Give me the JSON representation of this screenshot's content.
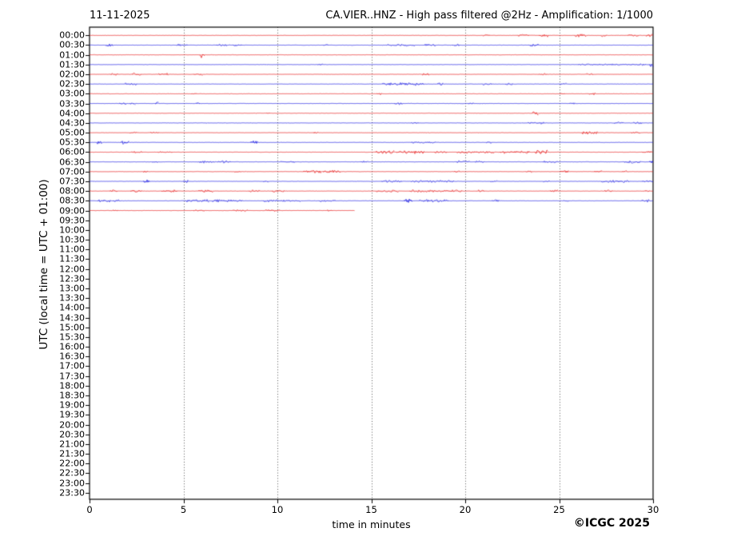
{
  "header": {
    "date": "11-11-2025",
    "title": "CA.VIER..HNZ - High pass filtered @2Hz - Amplification: 1/1000"
  },
  "footer": {
    "xlabel": "time in minutes",
    "copyright": "©ICGC 2025"
  },
  "chart_data": {
    "type": "line",
    "subtype": "helicorder-seismogram",
    "title": "CA.VIER..HNZ - High pass filtered @2Hz - Amplification: 1/1000",
    "date": "11-11-2025",
    "xlabel": "time in minutes",
    "ylabel": "UTC (local time = UTC + 01:00)",
    "xlim": [
      0,
      30
    ],
    "xticks": [
      "0",
      "5",
      "10",
      "15",
      "20",
      "25",
      "30"
    ],
    "grid_ticks_minutes": [
      5,
      10,
      15,
      20,
      25
    ],
    "grid": "vertical-dotted",
    "minutes_per_line": 30,
    "row_labels": [
      "00:00",
      "00:30",
      "01:00",
      "01:30",
      "02:00",
      "02:30",
      "03:00",
      "03:30",
      "04:00",
      "04:30",
      "05:00",
      "05:30",
      "06:00",
      "06:30",
      "07:00",
      "07:30",
      "08:00",
      "08:30",
      "09:00",
      "09:30",
      "10:00",
      "10:30",
      "11:00",
      "11:30",
      "12:00",
      "12:30",
      "13:00",
      "13:30",
      "14:00",
      "14:30",
      "15:00",
      "15:30",
      "16:00",
      "16:30",
      "17:00",
      "17:30",
      "18:00",
      "18:30",
      "19:00",
      "19:30",
      "20:00",
      "20:30",
      "21:00",
      "21:30",
      "22:00",
      "22:30",
      "23:00",
      "23:30"
    ],
    "colors": {
      "red": "#e51414",
      "blue": "#1919e0",
      "grid": "#555555",
      "frame": "#000000"
    },
    "last_data_row": "09:00",
    "traces": [
      {
        "label": "00:00",
        "color": "red",
        "start_min": 0,
        "end_min": 30,
        "bursts": [
          [
            20.9,
            21.3,
            1.4
          ],
          [
            22.8,
            23.4,
            1.6
          ],
          [
            23.9,
            24.4,
            1.8
          ],
          [
            25.8,
            26.4,
            1.9
          ],
          [
            27.2,
            27.5,
            1.7
          ],
          [
            28.6,
            29.2,
            1.6
          ],
          [
            29.6,
            30,
            1.8
          ]
        ]
      },
      {
        "label": "00:30",
        "color": "blue",
        "start_min": 0,
        "end_min": 30,
        "bursts": [
          [
            0.85,
            1.2,
            1.9
          ],
          [
            4.6,
            5.2,
            1.4
          ],
          [
            6.7,
            7.3,
            1.4
          ],
          [
            7.6,
            8.1,
            1.4
          ],
          [
            12.4,
            12.7,
            1.3
          ],
          [
            15.8,
            17.3,
            1.3
          ],
          [
            17.8,
            18.4,
            1.5
          ],
          [
            19.3,
            19.7,
            1.4
          ],
          [
            23.4,
            23.9,
            1.8
          ]
        ]
      },
      {
        "label": "01:00",
        "color": "red",
        "start_min": 0,
        "end_min": 30,
        "bursts": [
          [
            5.85,
            6.1,
            3.6
          ]
        ]
      },
      {
        "label": "01:30",
        "color": "blue",
        "start_min": 0,
        "end_min": 30,
        "bursts": [
          [
            12.1,
            12.4,
            1.2
          ],
          [
            26,
            29.6,
            1.25
          ],
          [
            29.75,
            30,
            2.6
          ]
        ]
      },
      {
        "label": "02:00",
        "color": "red",
        "start_min": 0,
        "end_min": 30,
        "bursts": [
          [
            1.1,
            1.5,
            1.3
          ],
          [
            2.25,
            2.75,
            1.6
          ],
          [
            3.65,
            4.15,
            1.5
          ],
          [
            5.5,
            6,
            1.3
          ],
          [
            17.7,
            18.05,
            1.7
          ],
          [
            23.9,
            24.3,
            1.3
          ],
          [
            26.4,
            26.8,
            1.3
          ]
        ]
      },
      {
        "label": "02:30",
        "color": "blue",
        "start_min": 0,
        "end_min": 30,
        "bursts": [
          [
            1.85,
            2.5,
            1.7
          ],
          [
            15.55,
            16.6,
            1.8
          ],
          [
            16.6,
            17.75,
            1.9
          ],
          [
            18.5,
            18.8,
            1.9
          ],
          [
            20.9,
            21.4,
            1.5
          ],
          [
            22.1,
            22.5,
            1.5
          ],
          [
            25,
            25.4,
            1.3
          ]
        ]
      },
      {
        "label": "03:00",
        "color": "red",
        "start_min": 0,
        "end_min": 30,
        "bursts": [
          [
            5.4,
            5.7,
            1.2
          ],
          [
            15.25,
            15.5,
            1.4
          ],
          [
            25,
            25.3,
            1.4
          ],
          [
            26.55,
            26.9,
            1.4
          ]
        ]
      },
      {
        "label": "03:30",
        "color": "blue",
        "start_min": 0,
        "end_min": 30,
        "bursts": [
          [
            1.55,
            1.95,
            1.6
          ],
          [
            2.1,
            2.4,
            1.6
          ],
          [
            3.45,
            3.65,
            2
          ],
          [
            5.65,
            5.85,
            1.9
          ],
          [
            16.2,
            16.6,
            1.6
          ],
          [
            20.1,
            20.4,
            1.3
          ],
          [
            25.5,
            25.8,
            1.3
          ]
        ]
      },
      {
        "label": "04:00",
        "color": "red",
        "start_min": 0,
        "end_min": 30,
        "bursts": [
          [
            9.4,
            9.6,
            1.2
          ],
          [
            23.55,
            23.85,
            2.2
          ]
        ]
      },
      {
        "label": "04:30",
        "color": "blue",
        "start_min": 0,
        "end_min": 30,
        "bursts": [
          [
            17.1,
            17.5,
            1.3
          ],
          [
            23.3,
            24.2,
            1.4
          ],
          [
            27.9,
            28.4,
            1.5
          ],
          [
            28.9,
            29.4,
            1.6
          ]
        ]
      },
      {
        "label": "05:00",
        "color": "red",
        "start_min": 0,
        "end_min": 30,
        "bursts": [
          [
            2.1,
            2.5,
            1.3
          ],
          [
            3.2,
            3.7,
            1.3
          ],
          [
            11.9,
            12.15,
            1.4
          ],
          [
            26.2,
            27,
            2.1
          ],
          [
            28.8,
            29.3,
            1.5
          ]
        ]
      },
      {
        "label": "05:30",
        "color": "blue",
        "start_min": 0,
        "end_min": 30,
        "bursts": [
          [
            0.35,
            0.6,
            2.1
          ],
          [
            1.65,
            2.05,
            2.6
          ],
          [
            8.55,
            8.9,
            2.6
          ],
          [
            17.1,
            18.4,
            1.3
          ],
          [
            21.1,
            21.4,
            1.3
          ]
        ]
      },
      {
        "label": "06:00",
        "color": "red",
        "start_min": 0,
        "end_min": 30,
        "bursts": [
          [
            2.2,
            2.8,
            1.2
          ],
          [
            3.6,
            4.4,
            1.2
          ],
          [
            15.2,
            16.2,
            1.9
          ],
          [
            16.3,
            17.8,
            2
          ],
          [
            18.3,
            19,
            1.5
          ],
          [
            19.5,
            21.5,
            1.6
          ],
          [
            21.8,
            23.4,
            1.7
          ],
          [
            23.7,
            24.35,
            2.7
          ],
          [
            29.4,
            29.9,
            1.5
          ]
        ]
      },
      {
        "label": "06:30",
        "color": "blue",
        "start_min": 0,
        "end_min": 30,
        "bursts": [
          [
            3.3,
            3.6,
            1.3
          ],
          [
            5.8,
            6.6,
            1.5
          ],
          [
            6.8,
            7.5,
            1.5
          ],
          [
            10.1,
            10.9,
            1.3
          ],
          [
            14.4,
            14.8,
            1.3
          ],
          [
            19.5,
            20.2,
            1.5
          ],
          [
            20.5,
            21,
            1.4
          ],
          [
            24.1,
            24.9,
            1.4
          ],
          [
            28.4,
            29.3,
            1.5
          ],
          [
            29.75,
            30,
            2.4
          ]
        ]
      },
      {
        "label": "07:00",
        "color": "red",
        "start_min": 0,
        "end_min": 30,
        "bursts": [
          [
            2.85,
            3.1,
            1.7
          ],
          [
            7.7,
            8,
            1.3
          ],
          [
            11.35,
            12.3,
            1.9
          ],
          [
            12.4,
            13.35,
            2
          ],
          [
            19.4,
            19.7,
            1.5
          ],
          [
            23.2,
            23.5,
            1.5
          ],
          [
            25.05,
            25.45,
            1.9
          ],
          [
            26.85,
            27.25,
            1.9
          ],
          [
            28.3,
            28.6,
            1.4
          ]
        ]
      },
      {
        "label": "07:30",
        "color": "blue",
        "start_min": 0,
        "end_min": 30,
        "bursts": [
          [
            2.85,
            3.15,
            2.2
          ],
          [
            4.95,
            5.2,
            2.2
          ],
          [
            9.2,
            9.5,
            1.4
          ],
          [
            15.5,
            16.6,
            1.5
          ],
          [
            17.1,
            19.4,
            1.5
          ],
          [
            21.3,
            21.7,
            1.3
          ],
          [
            24.1,
            24.5,
            1.3
          ],
          [
            27.2,
            28.7,
            1.7
          ],
          [
            29.4,
            30,
            1.5
          ]
        ]
      },
      {
        "label": "08:00",
        "color": "red",
        "start_min": 0,
        "end_min": 30,
        "bursts": [
          [
            1.05,
            1.45,
            1.7
          ],
          [
            2.15,
            2.75,
            1.8
          ],
          [
            3.8,
            4.65,
            1.8
          ],
          [
            5.75,
            6.55,
            1.8
          ],
          [
            8.45,
            9.05,
            1.5
          ],
          [
            9.7,
            10.35,
            1.5
          ],
          [
            15.2,
            16.4,
            1.5
          ],
          [
            17,
            19.8,
            1.5
          ],
          [
            20.6,
            21,
            1.7
          ],
          [
            24.5,
            24.9,
            1.7
          ],
          [
            27.4,
            27.8,
            1.5
          ],
          [
            29.5,
            29.8,
            1.4
          ]
        ]
      },
      {
        "label": "08:30",
        "color": "blue",
        "start_min": 0,
        "end_min": 30,
        "bursts": [
          [
            0.4,
            1.1,
            1.7
          ],
          [
            1.2,
            1.6,
            1.6
          ],
          [
            5.1,
            6.3,
            1.7
          ],
          [
            6.5,
            8.1,
            1.7
          ],
          [
            9.2,
            11.2,
            1.4
          ],
          [
            12.2,
            13.1,
            1.4
          ],
          [
            16.7,
            17.15,
            2.8
          ],
          [
            17.5,
            19.1,
            1.6
          ],
          [
            21.4,
            21.75,
            1.5
          ],
          [
            25.2,
            25.5,
            1.3
          ],
          [
            29.35,
            29.8,
            1.6
          ]
        ]
      },
      {
        "label": "09:00",
        "color": "red",
        "start_min": 0,
        "end_min": 14.1,
        "bursts": [
          [
            1.2,
            1.5,
            1.2
          ],
          [
            5.5,
            6.1,
            1.3
          ],
          [
            7.6,
            8.4,
            1.3
          ],
          [
            9.3,
            10.1,
            1.3
          ],
          [
            12.6,
            12.9,
            1.2
          ]
        ]
      }
    ]
  }
}
